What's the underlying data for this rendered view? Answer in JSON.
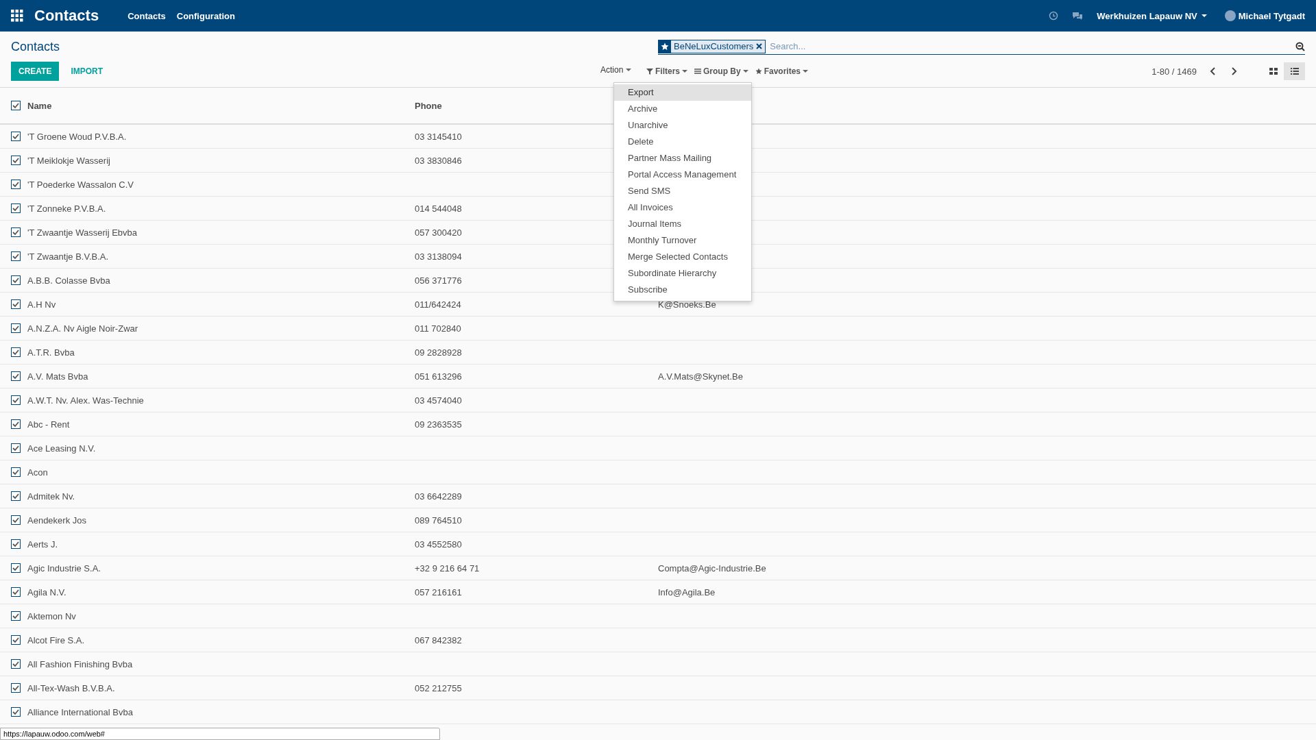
{
  "navbar": {
    "app_title": "Contacts",
    "menu": [
      "Contacts",
      "Configuration"
    ],
    "company": "Werkhuizen Lapauw NV",
    "user": "Michael Tytgadt"
  },
  "control_panel": {
    "breadcrumb": "Contacts",
    "buttons": [
      {
        "label": "CREATE",
        "kind": "primary"
      },
      {
        "label": "IMPORT",
        "kind": "link"
      }
    ],
    "search": {
      "facets": [
        {
          "label": "BeNeLuxCustomers"
        }
      ],
      "placeholder": "Search..."
    },
    "action": "Action",
    "options": [
      {
        "label": "Filters",
        "kind": "filter"
      },
      {
        "label": "Group By",
        "kind": "group"
      },
      {
        "label": "Favorites",
        "kind": "star"
      }
    ],
    "pager": "1-80 / 1469",
    "views": [
      {
        "kind": "kanban",
        "selected": false
      },
      {
        "kind": "list",
        "selected": true
      }
    ]
  },
  "action_menu": {
    "items": [
      {
        "label": "Export",
        "selected": true
      },
      {
        "label": "Archive",
        "selected": false
      },
      {
        "label": "Unarchive",
        "selected": false
      },
      {
        "label": "Delete",
        "selected": false
      },
      {
        "label": "Partner Mass Mailing",
        "selected": false
      },
      {
        "label": "Portal Access Management",
        "selected": false
      },
      {
        "label": "Send SMS",
        "selected": false
      },
      {
        "label": "All Invoices",
        "selected": false
      },
      {
        "label": "Journal Items",
        "selected": false
      },
      {
        "label": "Monthly Turnover",
        "selected": false
      },
      {
        "label": "Merge Selected Contacts",
        "selected": false
      },
      {
        "label": "Subordinate Hierarchy",
        "selected": false
      },
      {
        "label": "Subscribe",
        "selected": false
      }
    ]
  },
  "table": {
    "select_all_checked": true,
    "columns": [
      "Name",
      "Phone"
    ],
    "rows": [
      {
        "checked": true,
        "name": "'T Groene Woud P.V.B.A.",
        "phone": "03 3145410"
      },
      {
        "checked": true,
        "name": "'T Meiklokje Wasserij",
        "phone": "03 3830846"
      },
      {
        "checked": true,
        "name": "'T Poederke Wassalon C.V"
      },
      {
        "checked": true,
        "name": "'T Zonneke P.V.B.A.",
        "phone": "014 544048"
      },
      {
        "checked": true,
        "name": "'T Zwaantje Wasserij Ebvba",
        "phone": "057 300420"
      },
      {
        "checked": true,
        "name": "'T Zwaantje B.V.B.A.",
        "phone": "03 3138094"
      },
      {
        "checked": true,
        "name": "A.B.B. Colasse Bvba",
        "phone": "056 371776"
      },
      {
        "checked": true,
        "name": "A.H Nv",
        "phone": "011/642424",
        "email": "K@Snoeks.Be"
      },
      {
        "checked": true,
        "name": "A.N.Z.A. Nv Aigle Noir-Zwar",
        "phone": "011 702840"
      },
      {
        "checked": true,
        "name": "A.T.R. Bvba",
        "phone": "09 2828928"
      },
      {
        "checked": true,
        "name": "A.V. Mats Bvba",
        "phone": "051 613296",
        "email": "A.V.Mats@Skynet.Be"
      },
      {
        "checked": true,
        "name": "A.W.T. Nv. Alex. Was-Technie",
        "phone": "03 4574040"
      },
      {
        "checked": true,
        "name": "Abc - Rent",
        "phone": "09 2363535"
      },
      {
        "checked": true,
        "name": "Ace Leasing N.V."
      },
      {
        "checked": true,
        "name": "Acon"
      },
      {
        "checked": true,
        "name": "Admitek Nv.",
        "phone": "03 6642289"
      },
      {
        "checked": true,
        "name": "Aendekerk Jos",
        "phone": "089 764510"
      },
      {
        "checked": true,
        "name": "Aerts J.",
        "phone": "03 4552580"
      },
      {
        "checked": true,
        "name": "Agic Industrie S.A.",
        "phone": "+32 9 216 64 71",
        "email": "Compta@Agic-Industrie.Be"
      },
      {
        "checked": true,
        "name": "Agila N.V.",
        "phone": "057 216161",
        "email": "Info@Agila.Be"
      },
      {
        "checked": true,
        "name": "Aktemon Nv"
      },
      {
        "checked": true,
        "name": "Alcot Fire S.A.",
        "phone": "067 842382"
      },
      {
        "checked": true,
        "name": "All Fashion Finishing Bvba"
      },
      {
        "checked": true,
        "name": "All-Tex-Wash B.V.B.A.",
        "phone": "052 212755"
      },
      {
        "checked": true,
        "name": "Alliance International Bvba"
      }
    ]
  },
  "status_url": "https://lapauw.odoo.com/web#"
}
